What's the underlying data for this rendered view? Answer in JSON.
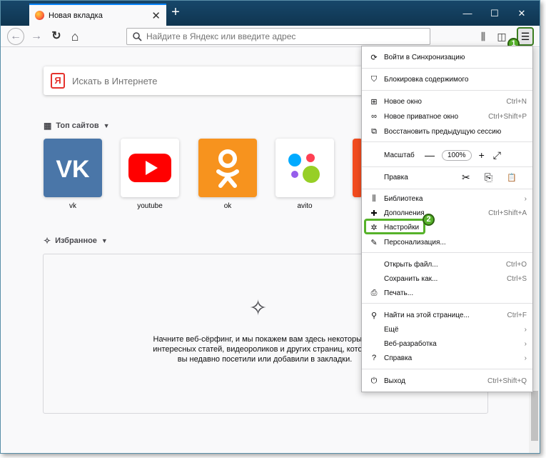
{
  "tab": {
    "title": "Новая вкладка",
    "close": "✕"
  },
  "window": {
    "minimize": "—",
    "maximize": "☐",
    "close": "✕",
    "new_tab": "+"
  },
  "toolbar": {
    "back": "←",
    "forward": "→",
    "reload": "↻",
    "home": "⌂",
    "url_placeholder": "Найдите в Яндекс или введите адрес",
    "library": "⫼",
    "sidebar": "◫",
    "menu": "☰"
  },
  "badges": {
    "one": "1",
    "two": "2"
  },
  "search": {
    "logo": "Я",
    "placeholder": "Искать в Интернете"
  },
  "top_sites": {
    "title": "Топ сайтов",
    "sites": [
      {
        "label": "vk",
        "color": "#4a76a8"
      },
      {
        "label": "youtube",
        "color": "#ffffff"
      },
      {
        "label": "ok",
        "color": "#f7931e"
      },
      {
        "label": "avito",
        "color": "#ffffff"
      }
    ]
  },
  "highlights": {
    "title": "Избранное",
    "empty_text": "Начните веб-сёрфинг, и мы покажем вам здесь некоторые из интересных статей, видеороликов и других страниц, которые вы недавно посетили или добавили в закладки."
  },
  "menu": {
    "sync": "Войти в Синхронизацию",
    "content_blocking": "Блокировка содержимого",
    "new_window": {
      "label": "Новое окно",
      "shortcut": "Ctrl+N"
    },
    "private_window": {
      "label": "Новое приватное окно",
      "shortcut": "Ctrl+Shift+P"
    },
    "restore_session": "Восстановить предыдущую сессию",
    "zoom": {
      "label": "Масштаб",
      "minus": "—",
      "value": "100%",
      "plus": "+",
      "fullscreen": "⤢"
    },
    "edit": {
      "label": "Правка",
      "cut": "✂",
      "copy": "⎘",
      "paste": "📋"
    },
    "library": "Библиотека",
    "addons": {
      "label": "Дополнения",
      "shortcut": "Ctrl+Shift+A"
    },
    "settings": "Настройки",
    "customize": "Персонализация...",
    "open_file": {
      "label": "Открыть файл...",
      "shortcut": "Ctrl+O"
    },
    "save_as": {
      "label": "Сохранить как...",
      "shortcut": "Ctrl+S"
    },
    "print": "Печать...",
    "find": {
      "label": "Найти на этой странице...",
      "shortcut": "Ctrl+F"
    },
    "more": "Ещё",
    "web_dev": "Веб-разработка",
    "help": "Справка",
    "exit": {
      "label": "Выход",
      "shortcut": "Ctrl+Shift+Q"
    }
  }
}
